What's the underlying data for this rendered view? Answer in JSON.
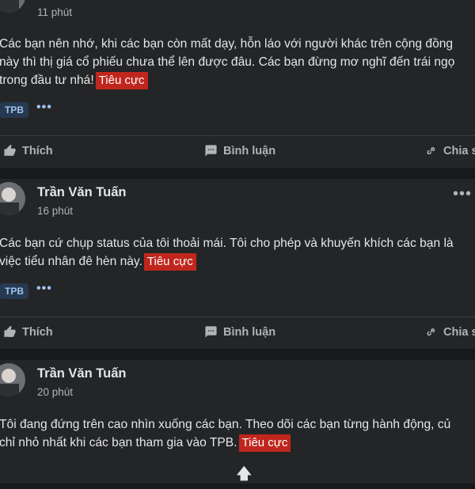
{
  "posts": [
    {
      "author": "",
      "time": "11 phút",
      "lines": [
        "Các bạn nên nhớ, khi các bạn còn mất dạy, hỗn láo với người khác trên cộng đồng",
        "này thì thị giá cổ phiếu chưa thể lên được đâu. Các bạn đừng mơ nghĩ đến trái ngọ",
        "trong đầu tư nhá!"
      ],
      "tag": "Tiêu cực",
      "stock": "TPB",
      "more": "•••"
    },
    {
      "author": "Trần Văn Tuấn",
      "time": "16 phút",
      "lines": [
        "Các bạn cứ chụp status của tôi thoải mái. Tôi cho phép và khuyến khích các bạn là",
        "việc tiểu nhân đê hèn này."
      ],
      "tag": "Tiêu cực",
      "stock": "TPB",
      "more": "•••"
    },
    {
      "author": "Trần Văn Tuấn",
      "time": "20 phút",
      "lines": [
        "Tôi đang đứng trên cao nhìn xuống các bạn. Theo dõi các bạn từng hành động, củ",
        "chỉ nhỏ nhất khi các bạn tham gia vào TPB."
      ],
      "tag": "Tiêu cực"
    }
  ],
  "actions": {
    "like": "Thích",
    "comment": "Bình luận",
    "share": "Chia s"
  },
  "icons": {
    "like": "thumbs-up-icon",
    "comment": "comment-icon",
    "share": "link-icon",
    "scroll": "up-arrow-icon"
  },
  "colors": {
    "background": "#18191a",
    "card": "#242526",
    "tag": "#c0261d",
    "chip": "#263951"
  }
}
